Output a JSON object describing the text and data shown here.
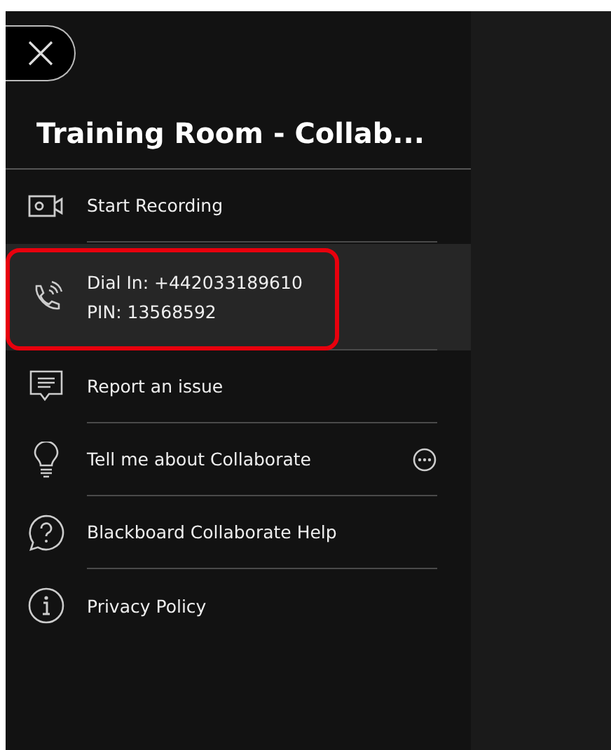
{
  "panel": {
    "title": "Training Room - Collab..."
  },
  "items": [
    {
      "kind": "recording",
      "lines": [
        "Start Recording"
      ],
      "selected": false,
      "highlighted": false,
      "more": false
    },
    {
      "kind": "phone",
      "lines": [
        "Dial In: +442033189610",
        "PIN: 13568592"
      ],
      "selected": true,
      "highlighted": true,
      "more": false
    },
    {
      "kind": "report",
      "lines": [
        "Report an issue"
      ],
      "selected": false,
      "highlighted": false,
      "more": false
    },
    {
      "kind": "bulb",
      "lines": [
        "Tell me about Collaborate"
      ],
      "selected": false,
      "highlighted": false,
      "more": true
    },
    {
      "kind": "help",
      "lines": [
        "Blackboard Collaborate Help"
      ],
      "selected": false,
      "highlighted": false,
      "more": false
    },
    {
      "kind": "info",
      "lines": [
        "Privacy Policy"
      ],
      "selected": false,
      "highlighted": false,
      "more": false
    }
  ]
}
